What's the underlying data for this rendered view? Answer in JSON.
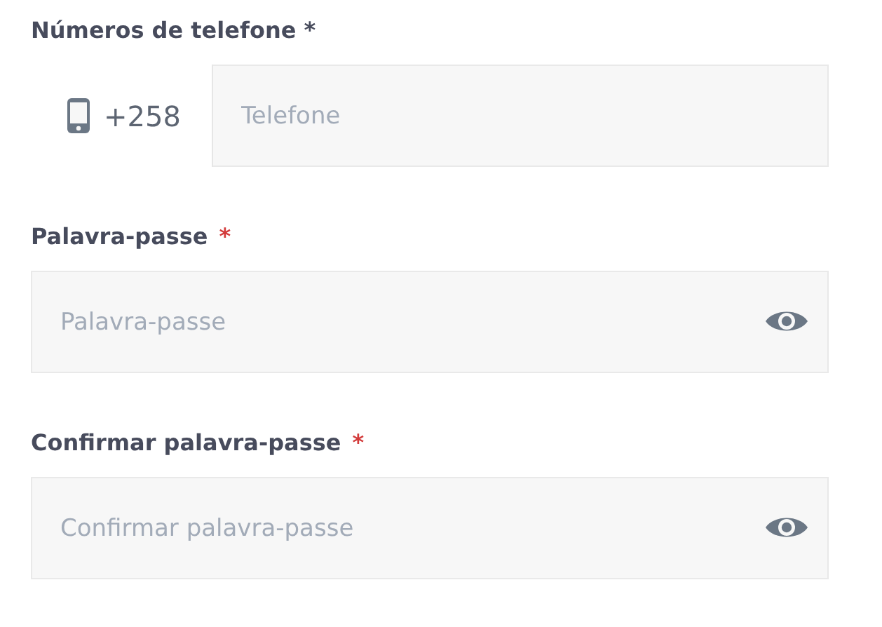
{
  "fields": [
    {
      "kind": "phone",
      "label": "Números de telefone *",
      "prefix": "+258",
      "placeholder": "Telefone"
    },
    {
      "kind": "password",
      "label": "Palavra-passe",
      "asterisk": "*",
      "placeholder": "Palavra-passe"
    },
    {
      "kind": "password",
      "label": "Confirmar palavra-passe",
      "asterisk": "*",
      "placeholder": "Confirmar palavra-passe"
    }
  ]
}
